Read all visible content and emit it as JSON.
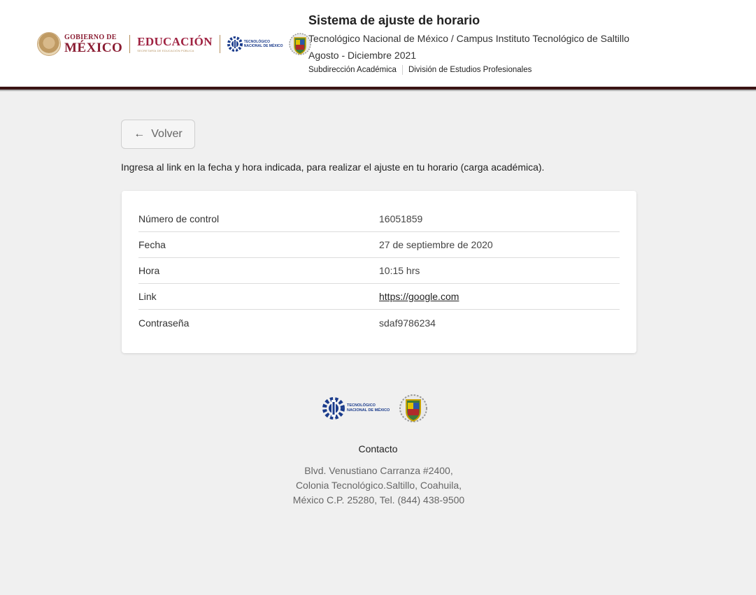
{
  "header": {
    "gov_logo": {
      "small": "GOBIERNO DE",
      "big": "MÉXICO"
    },
    "edu_logo": {
      "big": "EDUCACIÓN",
      "small": "SECRETARÍA DE EDUCACIÓN PÚBLICA"
    },
    "tecnm_logo": {
      "line1": "Tecnológico",
      "line2": "Nacional de México"
    },
    "title": "Sistema de ajuste de horario",
    "subtitle": "Tecnológico Nacional de México / Campus Instituto Tecnológico de Saltillo",
    "period": "Agosto - Diciembre 2021",
    "departments": [
      "Subdirección Académica",
      "División de Estudios Profesionales"
    ]
  },
  "main": {
    "back_label": "Volver",
    "back_icon": "arrow-left-icon",
    "intro": "Ingresa al link en la fecha y hora indicada, para realizar el ajuste en tu horario (carga académica).",
    "details": [
      {
        "label": "Número de control",
        "value": "16051859"
      },
      {
        "label": "Fecha",
        "value": "27 de septiembre de 2020"
      },
      {
        "label": "Hora",
        "value": "10:15 hrs"
      },
      {
        "label": "Link",
        "value": "https://google.com"
      },
      {
        "label": "Contraseña",
        "value": "sdaf9786234"
      }
    ]
  },
  "footer": {
    "tecnm_logo": {
      "line1": "Tecnológico",
      "line2": "Nacional de México"
    },
    "contact_title": "Contacto",
    "address_lines": [
      "Blvd. Venustiano Carranza #2400,",
      "Colonia Tecnológico.Saltillo, Coahuila,",
      "México C.P. 25280, Tel. (844) 438-9500"
    ]
  },
  "colors": {
    "header_border": "#3a1414",
    "gov_red": "#8a1c32",
    "edu_red": "#9f2241",
    "gold": "#b38e5d",
    "tecnm_blue": "#1b3c8c",
    "page_bg": "#f0f0f0"
  }
}
